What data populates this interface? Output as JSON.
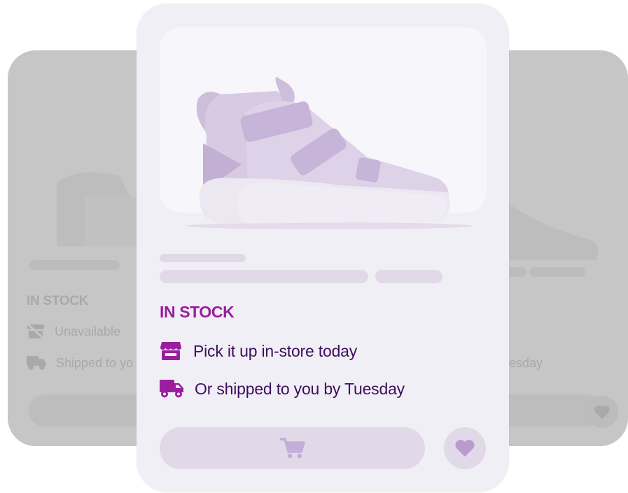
{
  "background_card": {
    "stock_label": "IN STOCK",
    "pickup_text": "Unavailable",
    "shipping_text": "Shipped to yo",
    "shipping_text_right": "esday"
  },
  "product_card": {
    "stock_label": "IN STOCK",
    "pickup_text": "Pick it up in-store today",
    "shipping_text": "Or shipped to you by Tuesday",
    "icons": {
      "pickup": "store-icon",
      "shipping": "truck-icon",
      "cart": "cart-icon",
      "favorite": "heart-icon"
    }
  },
  "colors": {
    "accent": "#9a1e9e",
    "text_dark": "#3d0f5c",
    "card_bg": "#f1eff6",
    "skeleton": "#e1d9e8",
    "background_card": "#c6c6c6"
  }
}
